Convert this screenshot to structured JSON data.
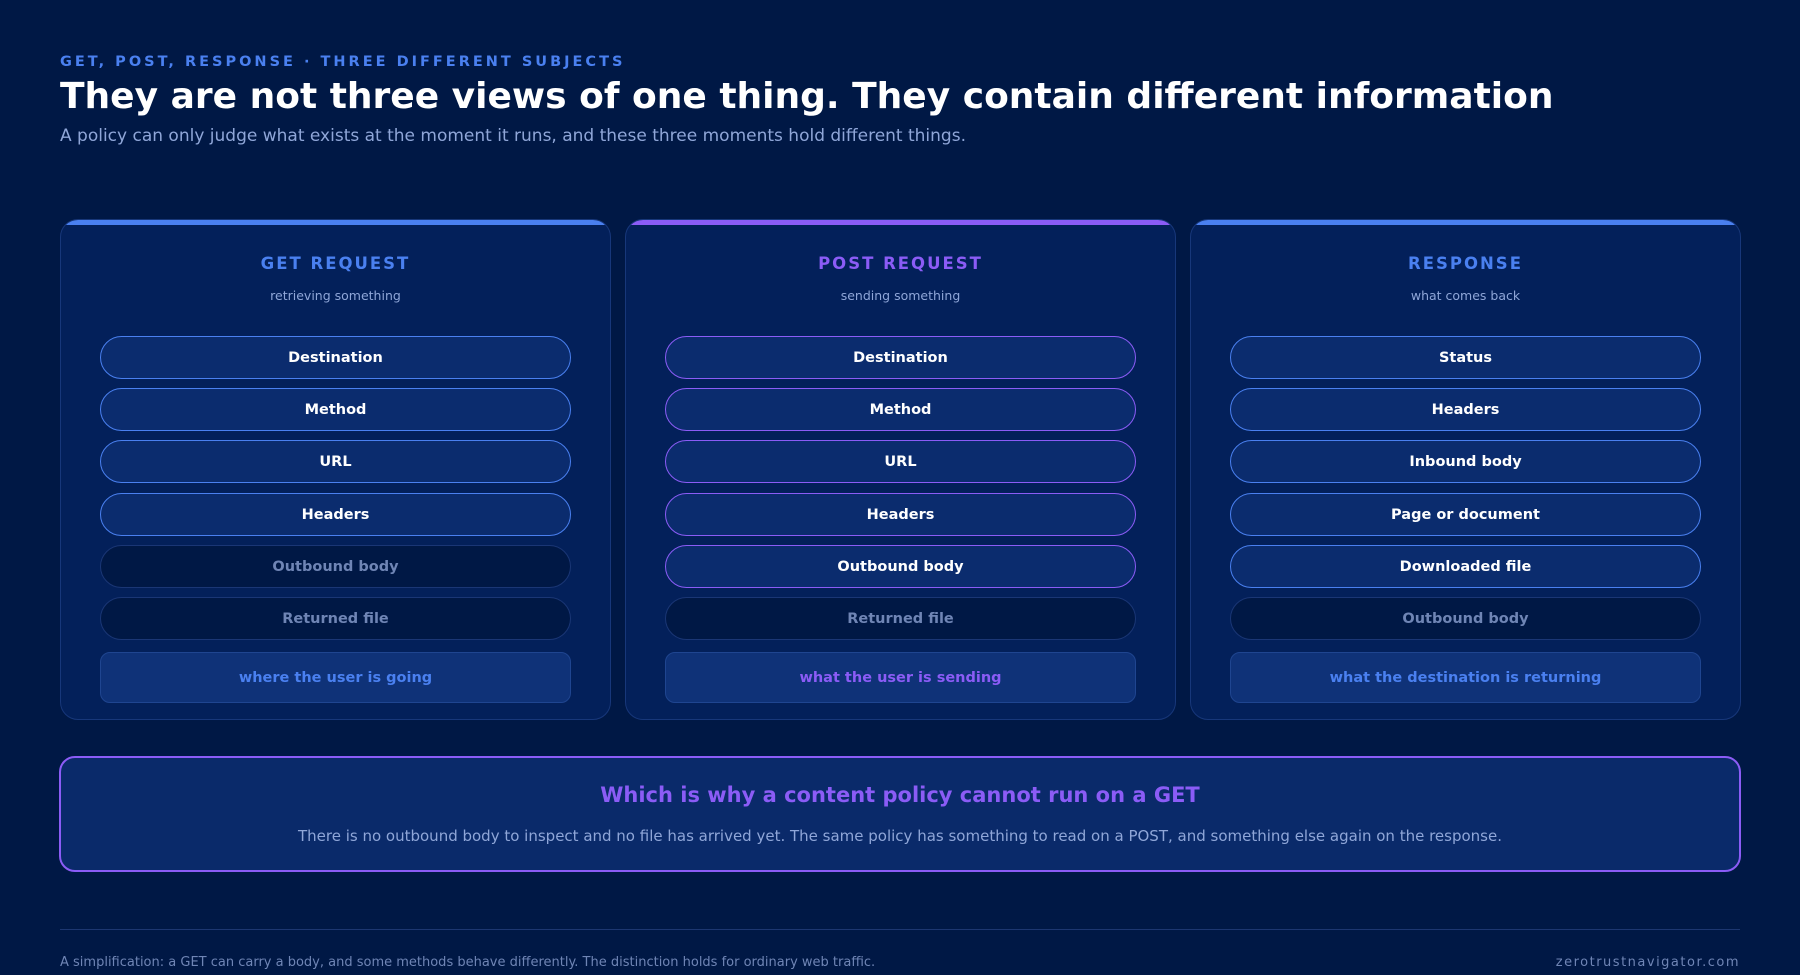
{
  "header": {
    "eyebrow": "GET, POST, RESPONSE · THREE DIFFERENT SUBJECTS",
    "title": "They are not three views of one thing. They contain different information",
    "subtitle": "A policy can only judge what exists at the moment it runs, and these three moments hold different things."
  },
  "colors": {
    "background": "#001845",
    "blue_accent": "#4a80f0",
    "purple_accent": "#8b5cf6"
  },
  "cards": [
    {
      "title": "GET REQUEST",
      "subtitle": "retrieving something",
      "accent": "#4a80f0",
      "items": [
        {
          "label": "Destination",
          "present": true
        },
        {
          "label": "Method",
          "present": true
        },
        {
          "label": "URL",
          "present": true
        },
        {
          "label": "Headers",
          "present": true
        },
        {
          "label": "Outbound body",
          "present": false
        },
        {
          "label": "Returned file",
          "present": false
        }
      ],
      "summary": "where the user is going"
    },
    {
      "title": "POST REQUEST",
      "subtitle": "sending something",
      "accent": "#8b5cf6",
      "items": [
        {
          "label": "Destination",
          "present": true
        },
        {
          "label": "Method",
          "present": true
        },
        {
          "label": "URL",
          "present": true
        },
        {
          "label": "Headers",
          "present": true
        },
        {
          "label": "Outbound body",
          "present": true
        },
        {
          "label": "Returned file",
          "present": false
        }
      ],
      "summary": "what the user is sending"
    },
    {
      "title": "RESPONSE",
      "subtitle": "what comes back",
      "accent": "#4a80f0",
      "items": [
        {
          "label": "Status",
          "present": true
        },
        {
          "label": "Headers",
          "present": true
        },
        {
          "label": "Inbound body",
          "present": true
        },
        {
          "label": "Page or document",
          "present": true
        },
        {
          "label": "Downloaded file",
          "present": true
        },
        {
          "label": "Outbound body",
          "present": false
        }
      ],
      "summary": "what the destination is returning"
    }
  ],
  "callout": {
    "title": "Which is why a content policy cannot run on a GET",
    "text": "There is no outbound body to inspect and no file has arrived yet. The same policy has something to read on a POST, and something else again on the response."
  },
  "footer": {
    "note": "A simplification: a GET can carry a body, and some methods behave differently. The distinction holds for ordinary web traffic.",
    "credit": "zerotrustnavigator.com"
  }
}
